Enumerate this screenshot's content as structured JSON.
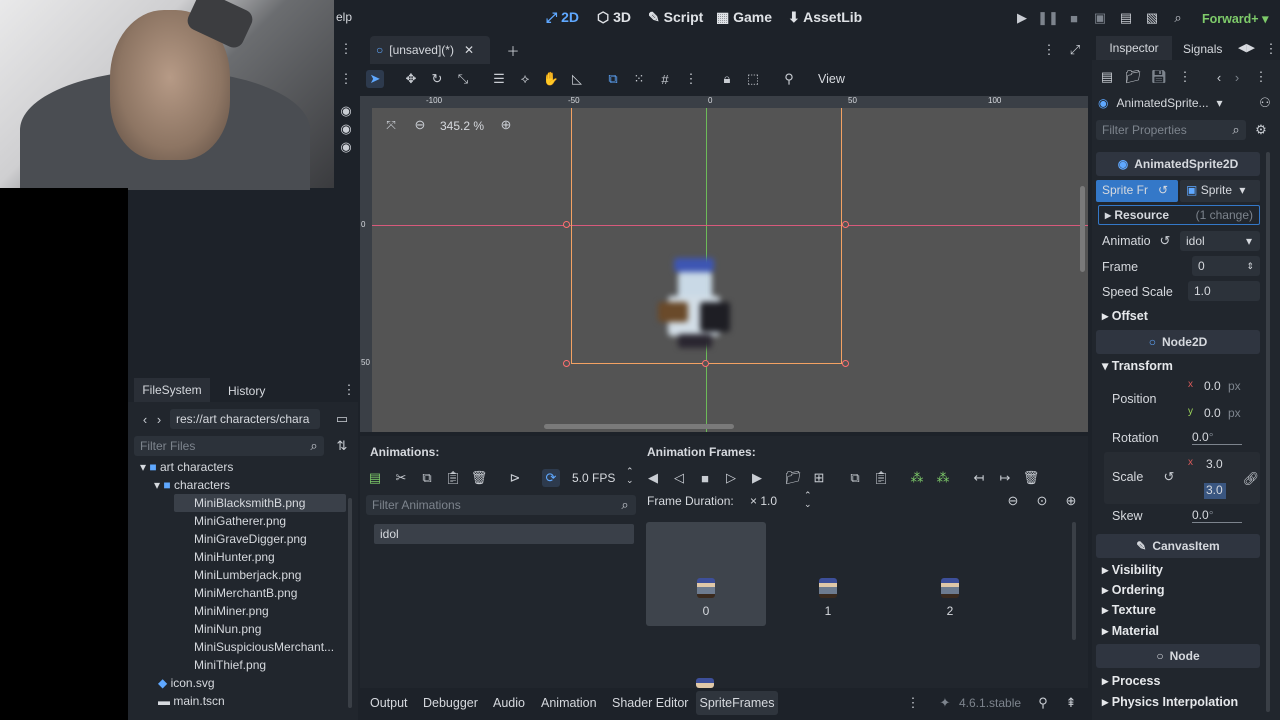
{
  "topbar": {
    "menu_fragment": "elp",
    "workspaces": [
      {
        "label": "2D",
        "active": true
      },
      {
        "label": "3D"
      },
      {
        "label": "Script"
      },
      {
        "label": "Game"
      },
      {
        "label": "AssetLib"
      }
    ],
    "renderer": "Forward+"
  },
  "scene_tab": {
    "title": "[unsaved](*)"
  },
  "viewport": {
    "zoom": "345.2 %",
    "view_menu": "View",
    "ruler_labels": [
      "-100",
      "-50",
      "0",
      "50",
      "100"
    ],
    "vruler_labels": [
      "0",
      "50"
    ]
  },
  "filesystem": {
    "tabs": [
      "FileSystem",
      "History"
    ],
    "path": "res://art characters/chara",
    "filter_placeholder": "Filter Files",
    "folders": [
      "art characters",
      "characters"
    ],
    "files": [
      "MiniBlacksmithB.png",
      "MiniGatherer.png",
      "MiniGraveDigger.png",
      "MiniHunter.png",
      "MiniLumberjack.png",
      "MiniMerchantB.png",
      "MiniMiner.png",
      "MiniNun.png",
      "MiniSuspiciousMerchant...",
      "MiniThief.png"
    ],
    "root_files": [
      "icon.svg",
      "main.tscn"
    ]
  },
  "animations_panel": {
    "title": "Animations:",
    "fps": "5.0 FPS",
    "filter_placeholder": "Filter Animations",
    "items": [
      "idol"
    ]
  },
  "frames_panel": {
    "title": "Animation Frames:",
    "frame_duration_label": "Frame Duration:",
    "frame_duration_value": "× 1.0",
    "frames": [
      "0",
      "1",
      "2"
    ]
  },
  "bottom_tabs": [
    "Output",
    "Debugger",
    "Audio",
    "Animation",
    "Shader Editor",
    "SpriteFrames"
  ],
  "version": "4.6.1.stable",
  "inspector": {
    "tabs": [
      "Inspector",
      "Signals"
    ],
    "node_name": "AnimatedSprite...",
    "filter_placeholder": "Filter Properties",
    "class_header": "AnimatedSprite2D",
    "sprite_frames_label": "Sprite Fr",
    "sprite_frames_value": "Sprite",
    "resource_label": "Resource",
    "resource_changes": "(1 change)",
    "animation_label": "Animatio",
    "animation_value": "idol",
    "frame_label": "Frame",
    "frame_value": "0",
    "speed_label": "Speed Scale",
    "speed_value": "1.0",
    "offset_label": "Offset",
    "node2d_header": "Node2D",
    "transform_label": "Transform",
    "position_label": "Position",
    "pos_x": "0.0",
    "pos_y": "0.0",
    "px": "px",
    "rotation_label": "Rotation",
    "rotation_value": "0.0",
    "scale_label": "Scale",
    "scale_x": "3.0",
    "scale_y": "3.0",
    "skew_label": "Skew",
    "skew_value": "0.0",
    "canvasitem_header": "CanvasItem",
    "canvas_sections": [
      "Visibility",
      "Ordering",
      "Texture",
      "Material"
    ],
    "node_header": "Node",
    "node_sections": [
      "Process",
      "Physics Interpolation"
    ]
  }
}
